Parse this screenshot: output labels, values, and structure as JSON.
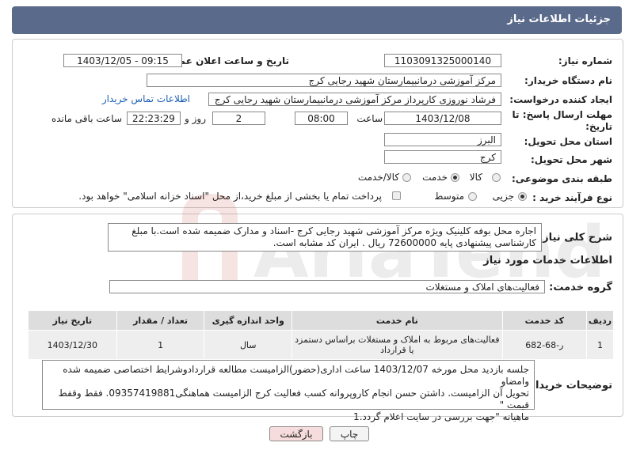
{
  "header": {
    "title": "جزئیات اطلاعات نیاز"
  },
  "need_number": {
    "label": "شماره نیاز:",
    "value": "1103091325000140"
  },
  "announce_date": {
    "label": "تاریخ و ساعت اعلان عمومی:",
    "value": "1403/12/05 - 09:15"
  },
  "buyer_org": {
    "label": "نام دستگاه خریدار:",
    "value": "مرکز آموزشی درمانبیمارستان شهید رجایی کرج"
  },
  "creator": {
    "label": "ایجاد کننده درخواست:",
    "value": "فرشاد نوروزی کارپرداز مرکز آموزشی درمانبیمارستان شهید رجایی کرج",
    "contact_link": "اطلاعات تماس خریدار"
  },
  "deadline": {
    "label_line1": "مهلت ارسال پاسخ: تا",
    "label_line2": "تاریخ:",
    "date": "1403/12/08",
    "time_label": "ساعت",
    "time": "08:00",
    "days": "2",
    "days_label": "روز و",
    "remaining": "22:23:29",
    "remaining_label": "ساعت باقی مانده"
  },
  "province": {
    "label": "استان محل تحویل:",
    "value": "البرز"
  },
  "city": {
    "label": "شهر محل تحویل:",
    "value": "کرج"
  },
  "category": {
    "label": "طبقه بندی موضوعی:",
    "options": [
      "کالا",
      "خدمت",
      "کالا/خدمت"
    ],
    "selected": "خدمت"
  },
  "process": {
    "label": "نوع فرآیند خرید :",
    "options": [
      "جزیی",
      "متوسط"
    ],
    "selected": "جزیی",
    "payment_note": "پرداخت تمام یا بخشی از مبلغ خرید،از محل \"اسناد خزانه اسلامی\" خواهد بود."
  },
  "general_desc": {
    "label": "شرح کلی نیاز:",
    "line1": "اجاره محل بوفه کلینیک ویژه مرکز آموزشی شهید رجایی کرج -اسناد و مدارک ضمیمه شده است.با مبلغ",
    "line2": "کارشناسی پیشنهادی پایه 72600000  ریال . ایران کد مشابه است."
  },
  "services_title": "اطلاعات خدمات مورد نیاز",
  "service_group": {
    "label": "گروه خدمت:",
    "value": "فعالیت‌های  املاک و مستغلات"
  },
  "table": {
    "headers": [
      "ردیف",
      "کد خدمت",
      "نام خدمت",
      "واحد اندازه گیری",
      "تعداد / مقدار",
      "تاریخ نیاز"
    ],
    "rows": [
      [
        "1",
        "ر-68-682",
        "فعالیت‌های مربوط به املاک و مستغلات براساس دستمزد یا قرارداد",
        "سال",
        "1",
        "1403/12/30"
      ]
    ]
  },
  "buyer_notes": {
    "label": "توضیحات خریدار:",
    "line1": "جلسه بازدید محل مورخه 1403/12/07 ساعت اداری(حضور)الزامیست مطالعه قراردادوشرایط اختصاصی ضمیمه شده وامضاو",
    "line2": "تحویل آن الزامیست. داشتن حسن انجام کاروپروانه کسب فعالیت کرج الزامیست هماهنگی09357419881. فقط وقفط قیمت \"",
    "line3": "ماهیانه \"جهت بررسی در سایت اعلام گردد.1"
  },
  "buttons": {
    "print": "چاپ",
    "back": "بازگشت"
  },
  "watermark_text": "AriaTender.neT",
  "colors": {
    "header": "#5a6a8a",
    "back_button": "#f6dcdc",
    "link": "#1a5fb4"
  }
}
